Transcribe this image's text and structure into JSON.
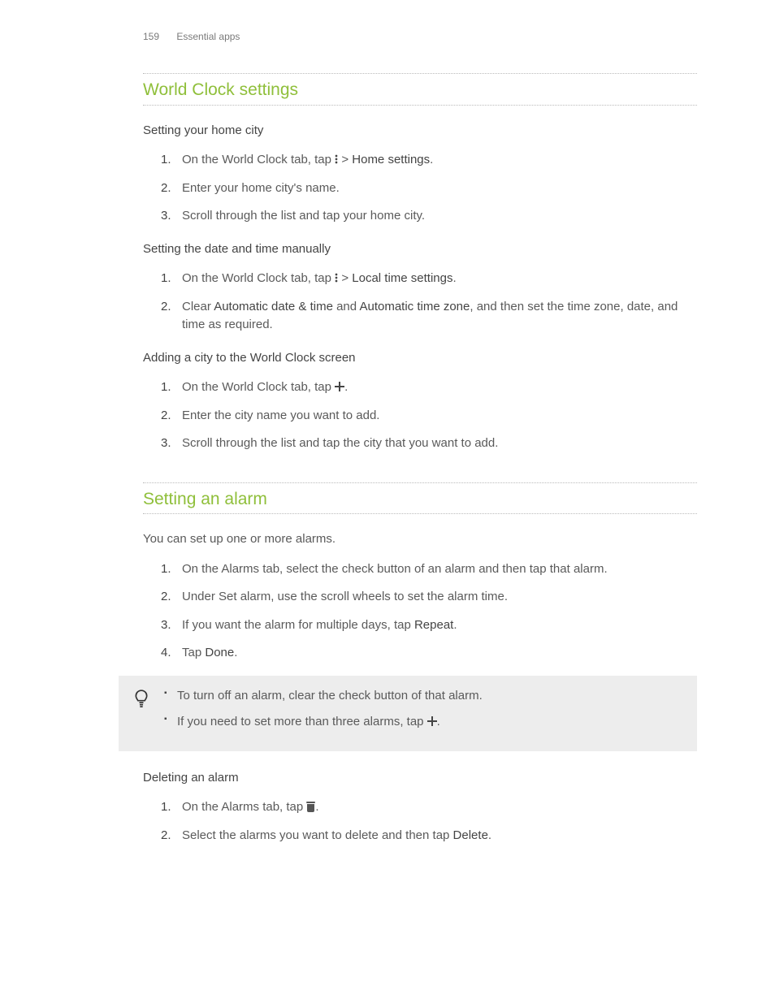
{
  "page": {
    "number": "159",
    "chapter": "Essential apps"
  },
  "section_world_clock": {
    "title": "World Clock settings",
    "sub_home": {
      "title": "Setting your home city",
      "steps": [
        {
          "num": "1.",
          "pre": "On the World Clock tab, tap ",
          "bold": "Home settings",
          "tail": "."
        },
        {
          "num": "2.",
          "text": "Enter your home city's name."
        },
        {
          "num": "3.",
          "text": "Scroll through the list and tap your home city."
        }
      ]
    },
    "sub_datetime": {
      "title": "Setting the date and time manually",
      "steps": [
        {
          "num": "1.",
          "pre": "On the World Clock tab, tap ",
          "bold": "Local time settings",
          "tail": "."
        },
        {
          "num": "2.",
          "pre": "Clear ",
          "b1": "Automatic date & time",
          "mid": " and ",
          "b2": "Automatic time zone",
          "tail": ", and then set the time zone, date, and time as required."
        }
      ]
    },
    "sub_addcity": {
      "title": "Adding a city to the World Clock screen",
      "steps": [
        {
          "num": "1.",
          "pre": "On the World Clock tab, tap ",
          "tail": "."
        },
        {
          "num": "2.",
          "text": "Enter the city name you want to add."
        },
        {
          "num": "3.",
          "text": "Scroll through the list and tap the city that you want to add."
        }
      ]
    }
  },
  "section_alarm": {
    "title": "Setting an alarm",
    "lead": "You can set up one or more alarms.",
    "steps": [
      {
        "num": "1.",
        "text": "On the Alarms tab, select the check button of an alarm and then tap that alarm."
      },
      {
        "num": "2.",
        "text": "Under Set alarm, use the scroll wheels to set the alarm time."
      },
      {
        "num": "3.",
        "pre": "If you want the alarm for multiple days, tap ",
        "bold": "Repeat",
        "tail": "."
      },
      {
        "num": "4.",
        "pre": "Tap ",
        "bold": "Done",
        "tail": "."
      }
    ],
    "tips": [
      {
        "text": "To turn off an alarm, clear the check button of that alarm."
      },
      {
        "pre": "If you need to set more than three alarms, tap ",
        "tail": "."
      }
    ],
    "sub_delete": {
      "title": "Deleting an alarm",
      "steps": [
        {
          "num": "1.",
          "pre": "On the Alarms tab, tap ",
          "tail": "."
        },
        {
          "num": "2.",
          "pre": "Select the alarms you want to delete and then tap ",
          "bold": "Delete",
          "tail": "."
        }
      ]
    }
  }
}
